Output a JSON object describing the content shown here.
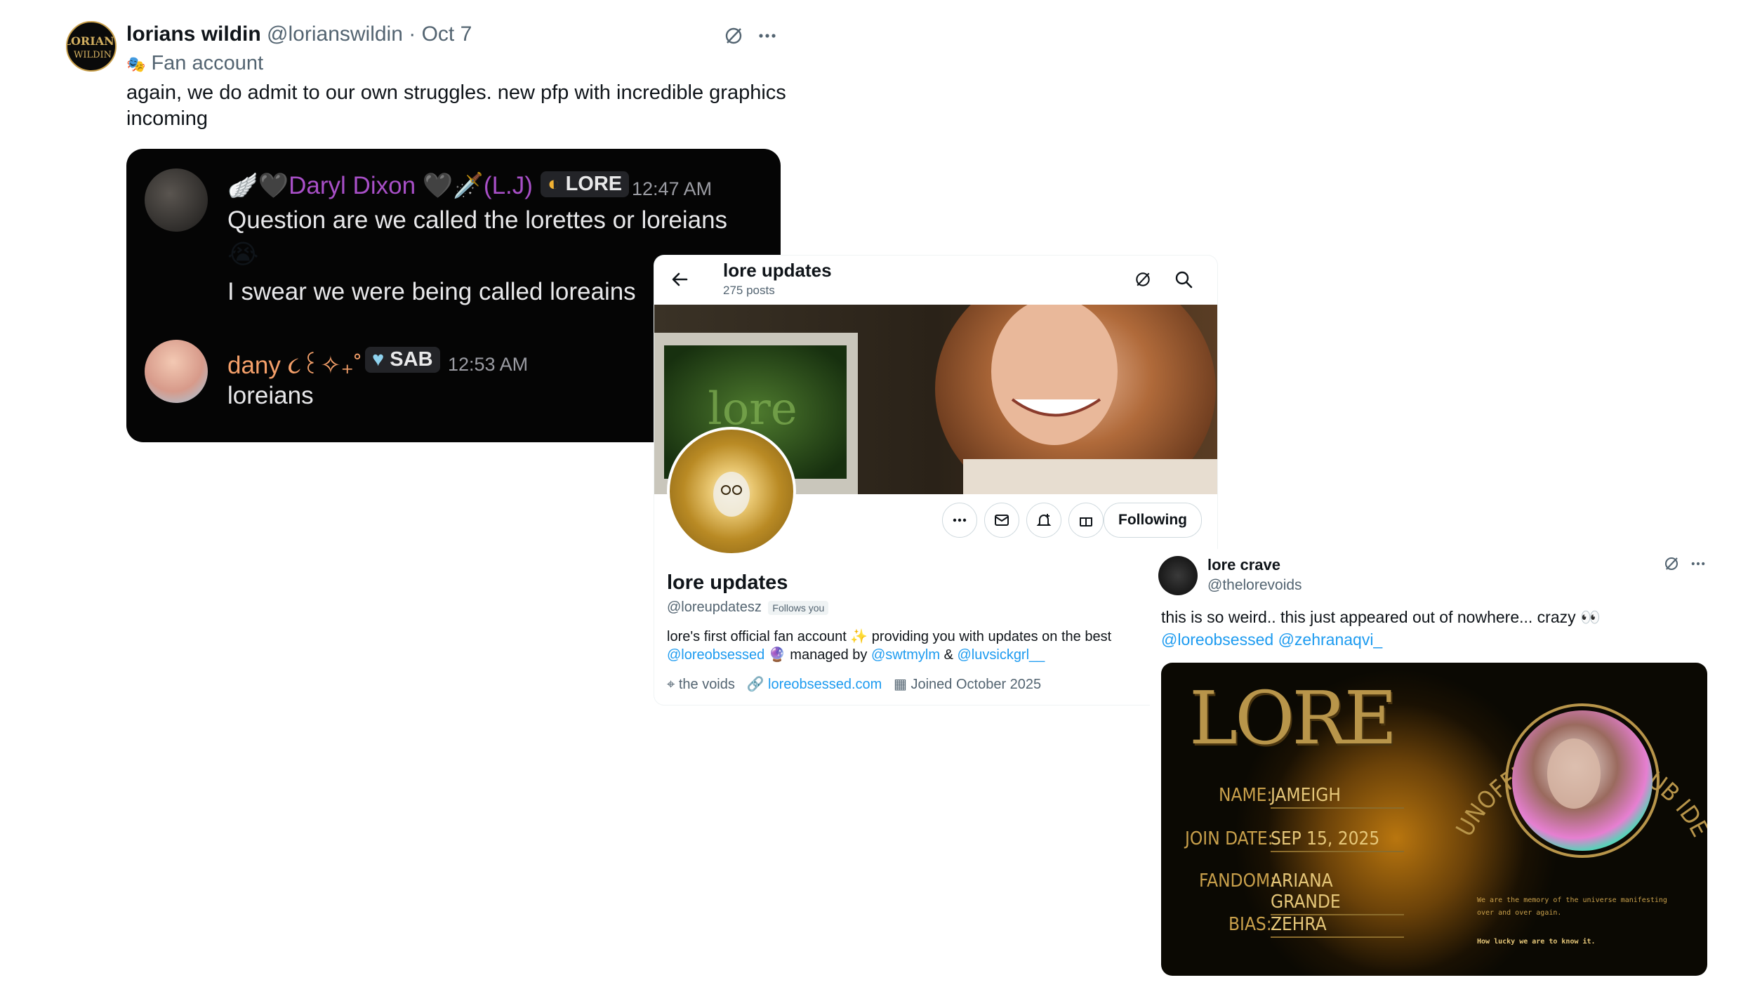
{
  "tweet1": {
    "display_name": "lorians wildin",
    "handle": "@lorianswildin",
    "date": "· Oct 7",
    "label_emoji": "🎭",
    "label": "Fan account",
    "text": "again, we do admit to our own struggles. new pfp with incredible graphics incoming",
    "avatar_text": "LORIANS WILDIN",
    "discord": {
      "msg1_name": "🪽🖤Daryl Dixon 🖤🗡️(L.J)",
      "msg1_tag": "LORE",
      "msg1_time": "12:47 AM",
      "msg1_line1": "Question are we called the lorettes or loreians",
      "msg1_emoji": "😭",
      "msg1_line2": "I swear we were being called loreains",
      "msg2_name": "dany ૮꒰✧₊˚⋆",
      "msg2_tag": "SAB",
      "msg2_time": "12:53 AM",
      "msg2_text": "loreians"
    }
  },
  "profile": {
    "title": "lore updates",
    "post_count": "275 posts",
    "name": "lore updates",
    "handle": "@loreupdatesz",
    "follows_you": "Follows you",
    "bio_1": "lore's first official fan account ✨ providing you with updates on the best",
    "bio_link1": "@loreobsessed",
    "bio_mid": "🔮 managed by",
    "bio_link2": "@swtmylm",
    "bio_amp": "&",
    "bio_link3": "@luvsickgrl__",
    "location": "the voids",
    "website": "loreobsessed.com",
    "joined": "Joined October 2025",
    "follow_button": "Following",
    "banner_screen_text": "lore"
  },
  "tweet3": {
    "display_name": "lore crave",
    "handle": "@thelorevoids",
    "text": "this is so weird.. this just appeared out of nowhere... crazy 👀",
    "mention1": "@loreobsessed",
    "mention2": "@zehranaqvi_",
    "card": {
      "logo": "LORE",
      "arc_text": "UNOFFICIAL FAN CLUB IDENTIFICATION CARD",
      "name_label": "NAME:",
      "name_value": "JAMEIGH",
      "join_label": "JOIN DATE:",
      "join_value": "SEP 15, 2025",
      "fandom_label": "FANDOM:",
      "fandom_value": "ARIANA GRANDE",
      "bias_label": "BIAS:",
      "bias_value": "ZEHRA",
      "quote": "We are the memory of the universe manifesting over and over again.",
      "quote2": "How lucky we are to know it."
    }
  },
  "colors": {
    "link": "#1d9bf0",
    "discord_purple": "#a84fc7",
    "discord_peach": "#f5a06a",
    "gold": "#c9a04b"
  }
}
